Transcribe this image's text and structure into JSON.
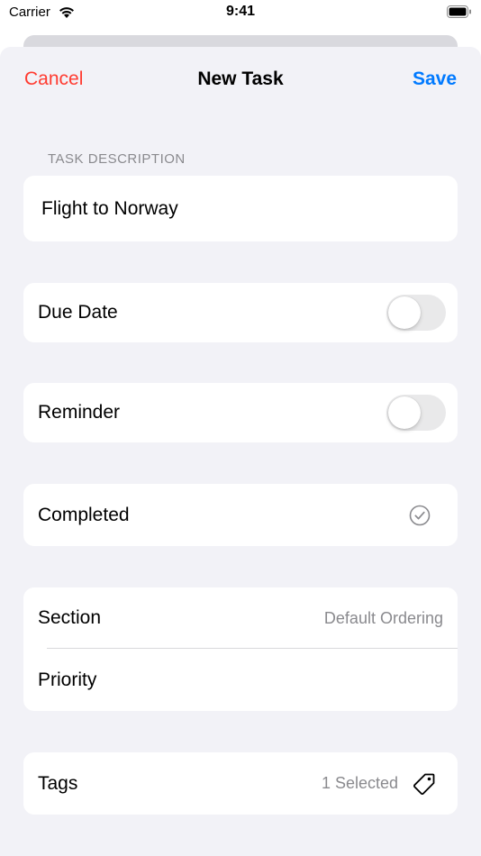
{
  "status_bar": {
    "carrier": "Carrier",
    "time": "9:41",
    "wifi_icon": "wifi-icon",
    "battery_icon": "battery-icon"
  },
  "nav": {
    "cancel_label": "Cancel",
    "title": "New Task",
    "save_label": "Save"
  },
  "colors": {
    "destructive": "#ff3b30",
    "accent": "#007aff",
    "secondary_text": "#8a8a8e",
    "grouped_background": "#f2f2f7"
  },
  "task_description": {
    "header": "TASK DESCRIPTION",
    "value": "Flight to Norway"
  },
  "due_date": {
    "label": "Due Date",
    "enabled": false
  },
  "reminder": {
    "label": "Reminder",
    "enabled": false
  },
  "completed": {
    "label": "Completed",
    "icon": "checkmark-circle-icon"
  },
  "section": {
    "label": "Section",
    "value": "Default Ordering"
  },
  "priority": {
    "label": "Priority"
  },
  "tags": {
    "label": "Tags",
    "value": "1 Selected",
    "icon": "tag-icon"
  }
}
